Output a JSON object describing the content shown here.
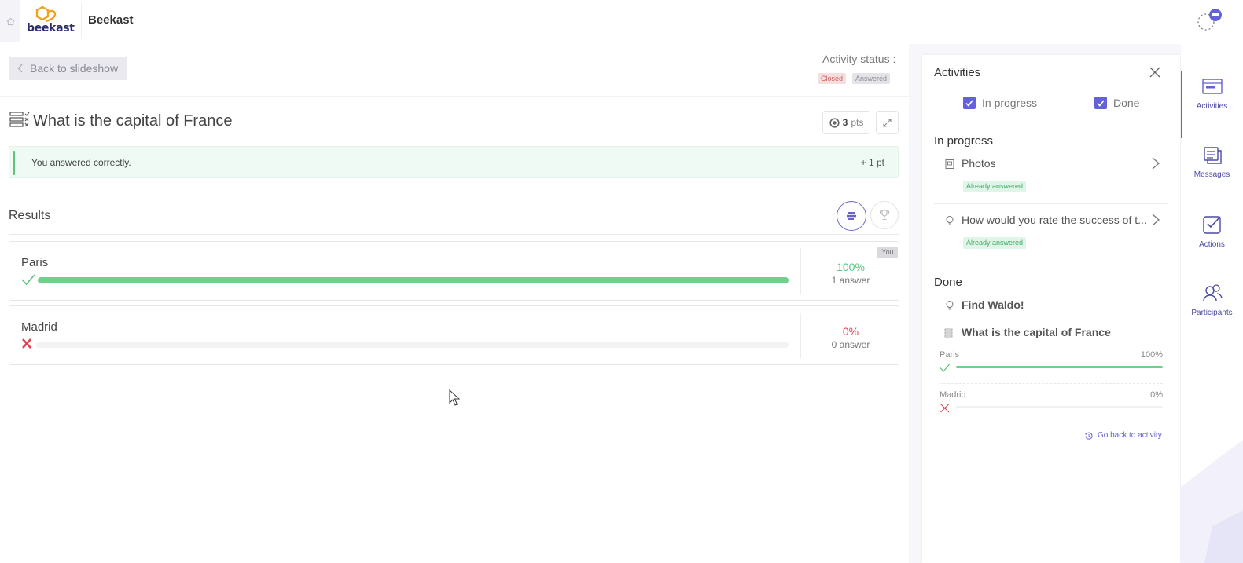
{
  "app": {
    "brand": "Beekast",
    "logo_text": "beekast",
    "home_icon": "home-icon"
  },
  "back_button": {
    "label": "Back to slideshow"
  },
  "activity_status": {
    "label": "Activity status :",
    "badges": [
      "Closed",
      "Answered"
    ]
  },
  "question": {
    "title": "What is the capital of France",
    "points_value": "3",
    "points_unit": "pts",
    "feedback": "You answered correctly.",
    "feedback_points": "+ 1 pt"
  },
  "results": {
    "title": "Results",
    "answers": [
      {
        "label": "Paris",
        "correct": true,
        "percent": "100%",
        "fill": 1.0,
        "count": "1 answer",
        "you": "You"
      },
      {
        "label": "Madrid",
        "correct": false,
        "percent": "0%",
        "fill": 0.0,
        "count": "0 answer"
      }
    ]
  },
  "panel": {
    "title": "Activities",
    "filters": [
      {
        "label": "In progress",
        "checked": true
      },
      {
        "label": "Done",
        "checked": true
      }
    ],
    "in_progress_title": "In progress",
    "in_progress": [
      {
        "label": "Photos",
        "badge": "Already answered"
      },
      {
        "label": "How would you rate the success of t...",
        "badge": "Already answered"
      }
    ],
    "done_title": "Done",
    "done": [
      {
        "label": "Find Waldo!"
      },
      {
        "label": "What is the capital of France"
      }
    ],
    "mini_results": [
      {
        "label": "Paris",
        "percent": "100%",
        "fill": 1.0,
        "correct": true
      },
      {
        "label": "Madrid",
        "percent": "0%",
        "fill": 0.0,
        "correct": false
      }
    ],
    "go_back": "Go back to activity"
  },
  "sidebar": {
    "items": [
      {
        "label": "Activities",
        "icon": "activities-icon",
        "active": true
      },
      {
        "label": "Messages",
        "icon": "messages-icon"
      },
      {
        "label": "Actions",
        "icon": "actions-icon"
      },
      {
        "label": "Participants",
        "icon": "participants-icon"
      }
    ]
  },
  "colors": {
    "accent": "#6561d8",
    "correct": "#5bc47d",
    "wrong": "#e0434f"
  }
}
